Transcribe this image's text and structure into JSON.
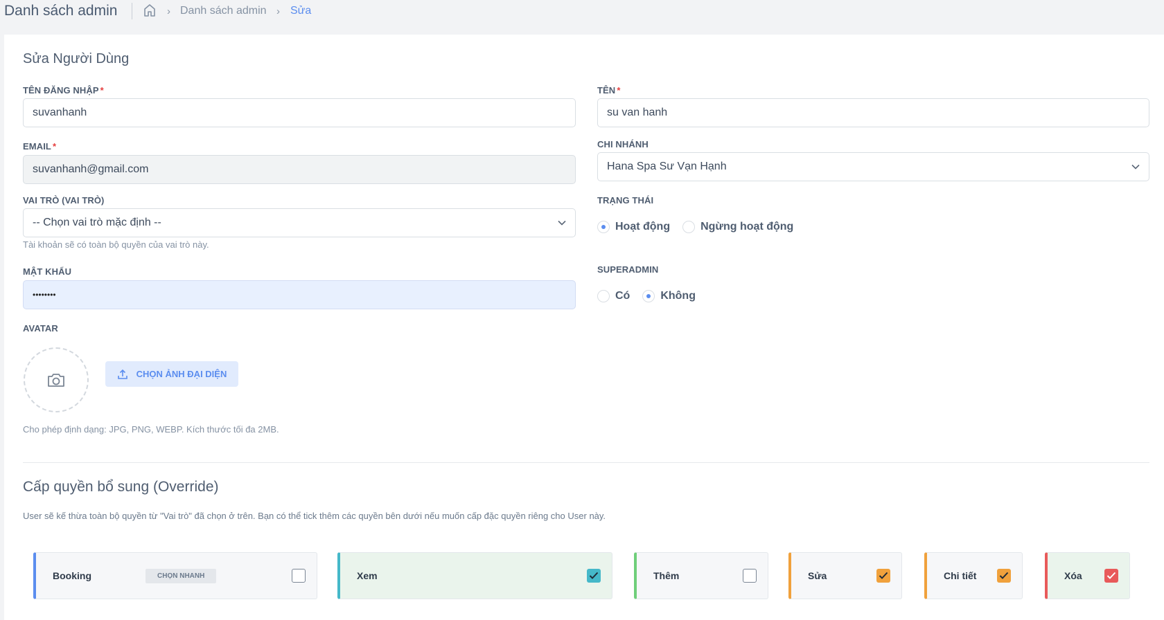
{
  "header": {
    "title": "Danh sách admin",
    "breadcrumb": {
      "list": "Danh sách admin",
      "current": "Sửa"
    }
  },
  "form": {
    "title": "Sửa Người Dùng",
    "username": {
      "label": "TÊN ĐĂNG NHẬP",
      "required": "*",
      "value": "suvanhanh"
    },
    "name": {
      "label": "TÊN",
      "required": "*",
      "value": "su van hanh"
    },
    "email": {
      "label": "EMAIL",
      "required": "*",
      "value": "suvanhanh@gmail.com"
    },
    "branch": {
      "label": "CHI NHÁNH",
      "selected": "Hana Spa Sư Vạn Hạnh"
    },
    "role": {
      "label": "VAI TRÒ (VAI TRÒ)",
      "selected": "-- Chọn vai trò mặc định --",
      "hint": "Tài khoản sẽ có toàn bộ quyền của vai trò này."
    },
    "status": {
      "label": "TRẠNG THÁI",
      "options": [
        "Hoạt động",
        "Ngừng hoạt động"
      ],
      "selected": "Hoạt động"
    },
    "password": {
      "label": "MẬT KHẨU",
      "value": "••••••••"
    },
    "superadmin": {
      "label": "SUPERADMIN",
      "options": [
        "Có",
        "Không"
      ],
      "selected": "Không"
    },
    "avatar": {
      "label": "AVATAR",
      "button": "CHỌN ẢNH ĐẠI DIỆN",
      "hint": "Cho phép định dạng: JPG, PNG, WEBP. Kích thước tối đa 2MB."
    }
  },
  "permissions": {
    "title": "Cấp quyền bổ sung (Override)",
    "description": "User sẽ kế thừa toàn bộ quyền từ \"Vai trò\" đã chọn ở trên. Bạn có thể tick thêm các quyền bên dưới nếu muốn cấp đặc quyền riêng cho User này.",
    "group": {
      "name": "Booking",
      "quick_select": "CHỌN NHANH",
      "checked": false
    },
    "items": [
      {
        "label": "Xem",
        "checked": true,
        "color": "#45b8c9"
      },
      {
        "label": "Thêm",
        "checked": false,
        "color": "#6fcf7a"
      },
      {
        "label": "Sửa",
        "checked": true,
        "color": "#f0a13c"
      },
      {
        "label": "Chi tiết",
        "checked": true,
        "color": "#f0a13c"
      },
      {
        "label": "Xóa",
        "checked": true,
        "color": "#e85a5a"
      }
    ]
  },
  "colors": {
    "accent": "#5b8def",
    "danger": "#e53e3e",
    "view_bg": "#eaf4ec"
  }
}
